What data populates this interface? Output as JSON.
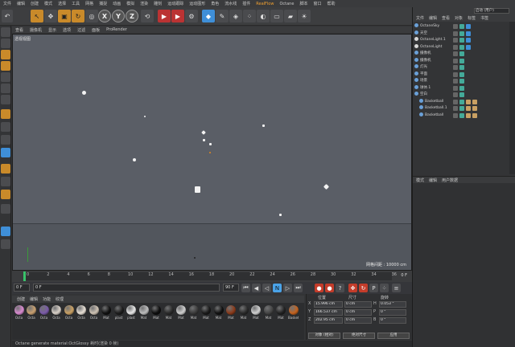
{
  "menubar": {
    "items": [
      "文件",
      "编辑",
      "创建",
      "模式",
      "选择",
      "工具",
      "网格",
      "捕捉",
      "动画",
      "模拟",
      "渲染",
      "雕刻",
      "运动跟踪",
      "运动图形",
      "角色",
      "流水线",
      "插件",
      "RealFlow",
      "Octane",
      "脚本",
      "窗口",
      "帮助"
    ],
    "highlight_index": 17
  },
  "toolbar": {
    "xyz": [
      "X",
      "Y",
      "Z"
    ]
  },
  "viewport": {
    "menu": [
      "查看",
      "摄像机",
      "显示",
      "选项",
      "过滤",
      "面板",
      "ProRender"
    ],
    "label": "透视视图",
    "grid_readout": "网格间距 : 10000 cm"
  },
  "timeline": {
    "ticks": [
      "0",
      "2",
      "4",
      "6",
      "8",
      "10",
      "12",
      "14",
      "16",
      "18",
      "20",
      "22",
      "24",
      "26",
      "28",
      "30",
      "32",
      "34",
      "36"
    ],
    "end_label": "0 F"
  },
  "transport": {
    "start_frame": "0 F",
    "frame_field": "0 F",
    "end_frame": "90 F",
    "end_frame2": "90 F"
  },
  "materials": {
    "menu": [
      "创建",
      "编辑",
      "功能",
      "纹理"
    ],
    "items": [
      {
        "label": "Octa",
        "color": "#d98ad0"
      },
      {
        "label": "Octa",
        "color": "#c8a070"
      },
      {
        "label": "Octa",
        "color": "#7a5aa8"
      },
      {
        "label": "Octa",
        "color": "#d8d0c8"
      },
      {
        "label": "Octa",
        "color": "#c9a063"
      },
      {
        "label": "Octa",
        "color": "#e8e0d6"
      },
      {
        "label": "Octa",
        "color": "#cfc3b4"
      },
      {
        "label": "Mat",
        "color": "#111111"
      },
      {
        "label": "plast",
        "color": "#1c1c1c"
      },
      {
        "label": "plast",
        "color": "#e8e8e8"
      },
      {
        "label": "Mat",
        "color": "#bdbdbd"
      },
      {
        "label": "Mat",
        "color": "#0e0e0e"
      },
      {
        "label": "Mat",
        "color": "#2a2a2a"
      },
      {
        "label": "Mat",
        "color": "#cfcfcf"
      },
      {
        "label": "Mat",
        "color": "#3a3a3a"
      },
      {
        "label": "Mat",
        "color": "#1a1a1a"
      },
      {
        "label": "Mat",
        "color": "#111111"
      },
      {
        "label": "Mat",
        "color": "#8a3a1a"
      },
      {
        "label": "Mat",
        "color": "#2a2a2a"
      },
      {
        "label": "Mat",
        "color": "#d0d0d0"
      },
      {
        "label": "Mat",
        "color": "#444444"
      },
      {
        "label": "Mat",
        "color": "#222222"
      },
      {
        "label": "Basket",
        "color": "#c4621e"
      }
    ]
  },
  "coords": {
    "headers": [
      "位置",
      "尺寸",
      "旋转"
    ],
    "rows": [
      {
        "axis": "X",
        "pos": "15.996 cm",
        "size": "0 cm",
        "rot_axis": "H",
        "rot": "0.053 °"
      },
      {
        "axis": "Y",
        "pos": "166.537 cm",
        "size": "0 cm",
        "rot_axis": "P",
        "rot": "0 °"
      },
      {
        "axis": "Z",
        "pos": "202.95 cm",
        "size": "0 cm",
        "rot_axis": "B",
        "rot": "0 °"
      }
    ],
    "mode1": "对象 (相对)",
    "mode2": "绝对尺寸",
    "apply": "应用"
  },
  "status": "Octane generate material:OctGlossy  耗时(渲染 0 帧)",
  "right": {
    "layout": "启动 (用户)",
    "obj_menu": [
      "文件",
      "编辑",
      "查看",
      "对象",
      "标签",
      "书签"
    ],
    "objects": [
      {
        "name": "OctaneSky",
        "indent": 0,
        "color": "#6aa0d8"
      },
      {
        "name": "天空",
        "indent": 0,
        "color": "#6aa0d8"
      },
      {
        "name": "OctaneLight.1",
        "indent": 0,
        "color": "#d8d8d8"
      },
      {
        "name": "OctaneLight",
        "indent": 0,
        "color": "#d8d8d8"
      },
      {
        "name": "摄像机",
        "indent": 0,
        "color": "#6aa0d8"
      },
      {
        "name": "摄像机",
        "indent": 0,
        "color": "#6aa0d8"
      },
      {
        "name": "灯光",
        "indent": 0,
        "color": "#6aa0d8"
      },
      {
        "name": "平面",
        "indent": 0,
        "color": "#6aa0d8"
      },
      {
        "name": "场景",
        "indent": 0,
        "color": "#6aa0d8"
      },
      {
        "name": "球体.1",
        "indent": 0,
        "color": "#6aa0d8"
      },
      {
        "name": "空白",
        "indent": 0,
        "color": "#6aa0d8"
      },
      {
        "name": "Basketball",
        "indent": 1,
        "color": "#6aa0d8"
      },
      {
        "name": "Basketball.1",
        "indent": 1,
        "color": "#6aa0d8"
      },
      {
        "name": "Basketball",
        "indent": 1,
        "color": "#6aa0d8"
      }
    ],
    "attr_menu": [
      "模式",
      "编辑",
      "用户数据"
    ]
  }
}
